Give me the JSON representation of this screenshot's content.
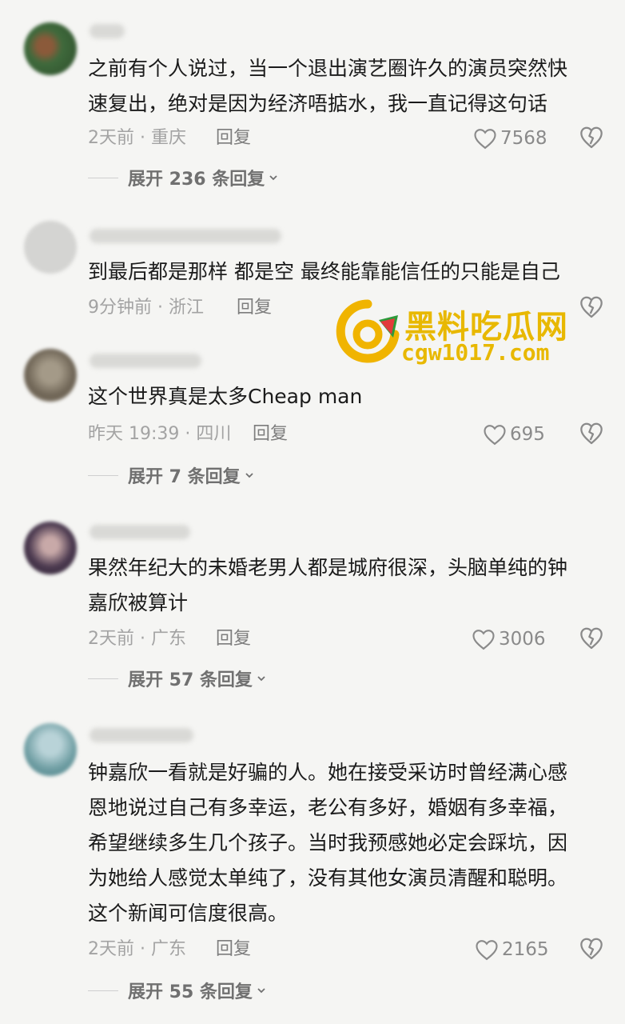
{
  "comments": [
    {
      "text": "之前有个人说过，当一个退出演艺圈许久的演员突然快\n速复出，绝对是因为经济唔掂水，我一直记得这句话",
      "meta": "2天前 · 重庆",
      "reply_label": "回复",
      "likes": "7568",
      "expand_label": "展开 236 条回复",
      "avatar_color": "#3f6a3c"
    },
    {
      "text": "到最后都是那样 都是空 最终能靠能信任的只能是自己",
      "meta": "9分钟前 · 浙江",
      "reply_label": "回复",
      "likes": "",
      "avatar_color": "#d0d0d0"
    },
    {
      "text": "这个世界真是太多Cheap man",
      "meta": "昨天 19:39 · 四川",
      "reply_label": "回复",
      "likes": "695",
      "expand_label": "展开 7 条回复",
      "avatar_color": "#8a7f6e"
    },
    {
      "text": "果然年纪大的未婚老男人都是城府很深，头脑单纯的钟\n嘉欣被算计",
      "meta": "2天前 · 广东",
      "reply_label": "回复",
      "likes": "3006",
      "expand_label": "展开 57 条回复",
      "avatar_color": "#5a4a5e"
    },
    {
      "text": "钟嘉欣一看就是好骗的人。她在接受采访时曾经满心感\n恩地说过自己有多幸运，老公有多好，婚姻有多幸福，\n希望继续多生几个孩子。当时我预感她必定会踩坑，因\n为她给人感觉太单纯了，没有其他女演员清醒和聪明。\n这个新闻可信度很高。",
      "meta": "2天前 · 广东",
      "reply_label": "回复",
      "likes": "2165",
      "expand_label": "展开 55 条回复",
      "avatar_color": "#7fa7a8"
    }
  ],
  "watermark": {
    "title": "黑料吃瓜网",
    "url": "cgw1017.com",
    "color": "#e8b800"
  }
}
